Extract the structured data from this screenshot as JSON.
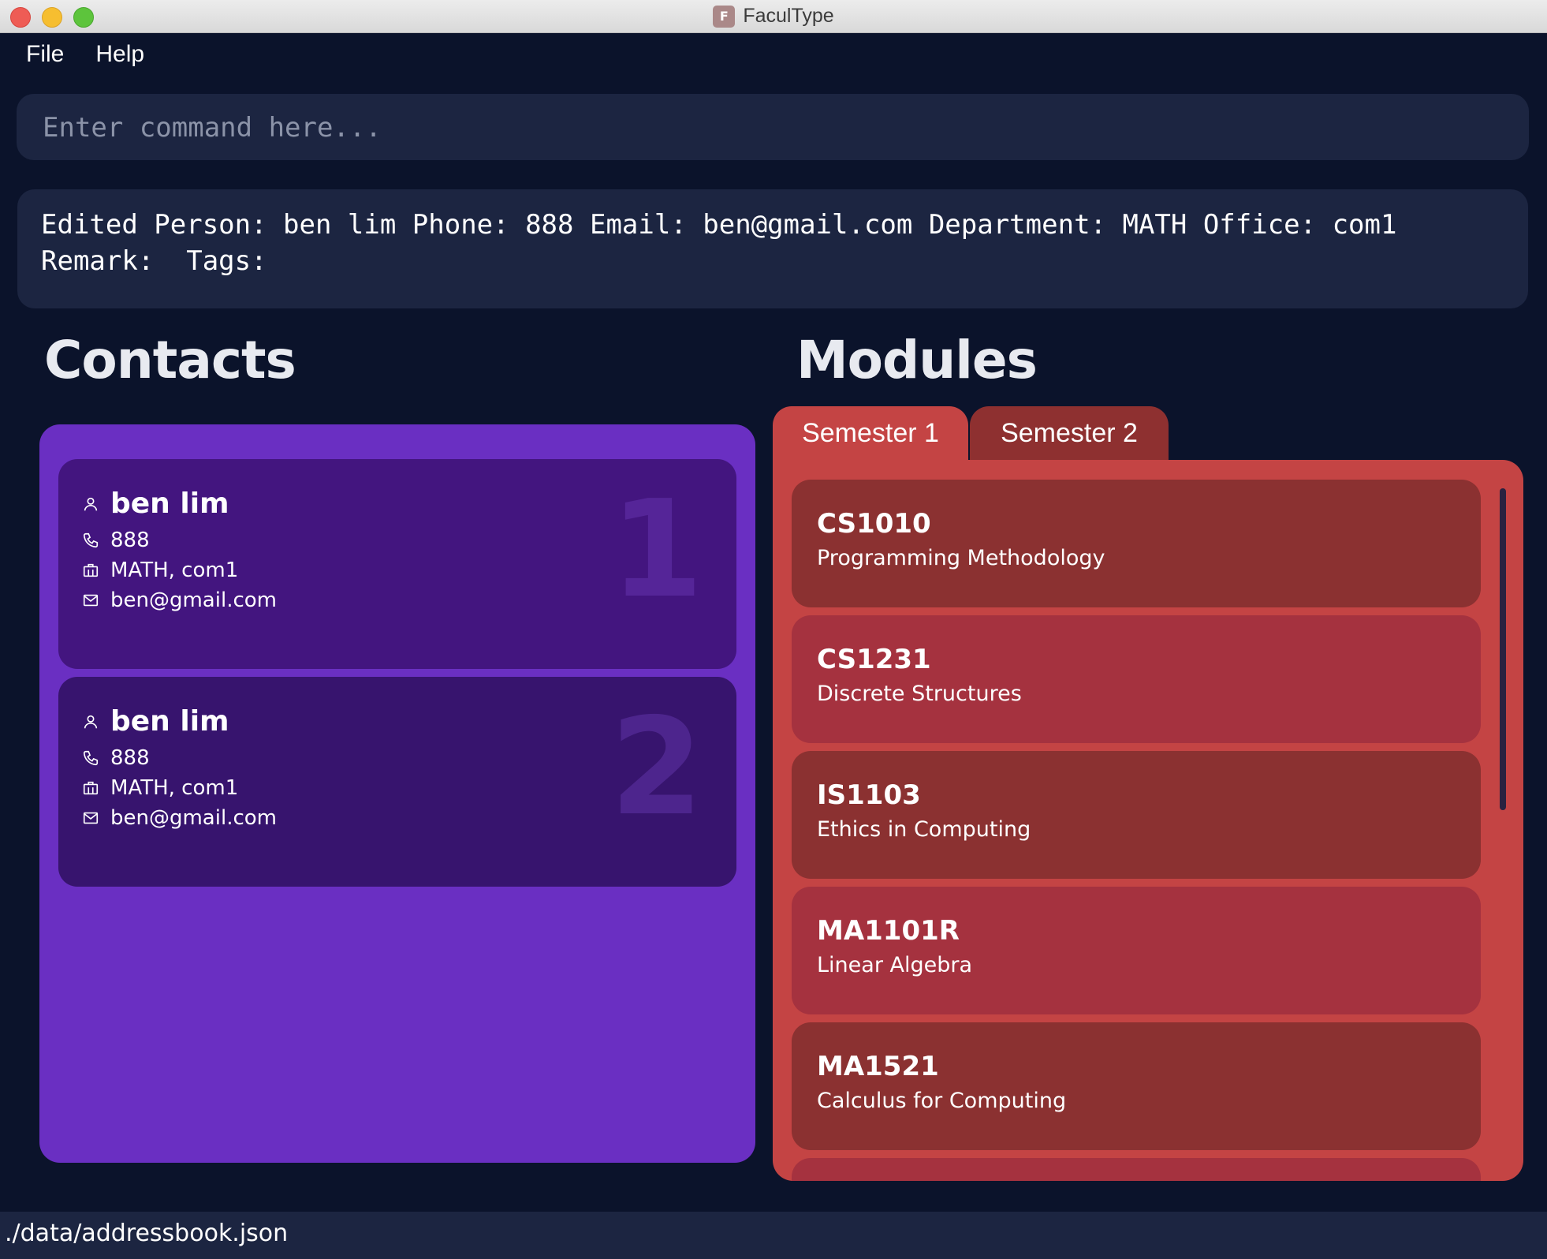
{
  "window": {
    "title": "FaculType"
  },
  "menu": {
    "file": "File",
    "help": "Help"
  },
  "command": {
    "placeholder": "Enter command here...",
    "value": ""
  },
  "result": {
    "text": "Edited Person: ben lim Phone: 888 Email: ben@gmail.com Department: MATH Office: com1\nRemark:  Tags:"
  },
  "contacts": {
    "heading": "Contacts",
    "items": [
      {
        "index": "1",
        "name": "ben lim",
        "phone": "888",
        "office": "MATH, com1",
        "email": "ben@gmail.com"
      },
      {
        "index": "2",
        "name": "ben lim",
        "phone": "888",
        "office": "MATH, com1",
        "email": "ben@gmail.com"
      }
    ]
  },
  "modules": {
    "heading": "Modules",
    "tabs": [
      {
        "label": "Semester 1",
        "active": true
      },
      {
        "label": "Semester 2",
        "active": false
      }
    ],
    "items": [
      {
        "code": "CS1010",
        "name": "Programming Methodology"
      },
      {
        "code": "CS1231",
        "name": "Discrete Structures"
      },
      {
        "code": "IS1103",
        "name": "Ethics in Computing"
      },
      {
        "code": "MA1101R",
        "name": "Linear Algebra"
      },
      {
        "code": "MA1521",
        "name": "Calculus for Computing"
      }
    ]
  },
  "status": {
    "path": "./data/addressbook.json"
  },
  "colors": {
    "background": "#0b132b",
    "panel": "#1c2541",
    "contacts_panel": "#6a2fc2",
    "modules_panel": "#c44444"
  }
}
